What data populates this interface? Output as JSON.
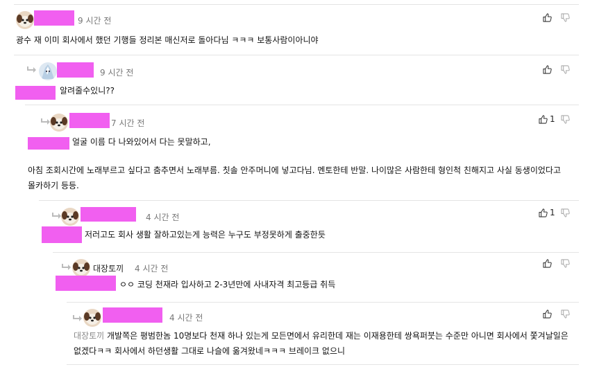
{
  "comments": [
    {
      "time": "9 시간 전",
      "body": "광수 재 이미 회사에서 했던 기행들 정리본 매신저로 돌아다님 ㅋㅋㅋ 보통사람이아니야",
      "likes": "",
      "avatar_icon": "dog-avatar-icon"
    },
    {
      "time": "9 시간 전",
      "body": "알려줄수있니??",
      "likes": "",
      "avatar_icon": "ice-avatar-icon"
    },
    {
      "time": "7 시간 전",
      "body_line1": "얼굴 이름 다 나와있어서 다는 못말하고,",
      "body_para2": "아침 조회시간에 노래부르고 싶다고 춤추면서 노래부름. 칫솔 안주머니에 넣고다님. 멘토한테 반말. 나이많은 사람한테 형인척 친해지고 사실 동생이었다고 몰카하기 등등.",
      "likes": "1",
      "avatar_icon": "dog-avatar-icon"
    },
    {
      "time": "4 시간 전",
      "body": "저러고도 회사 생활 잘하고있는게 능력은 누구도 부정못하게 출중한듯",
      "likes": "1",
      "avatar_icon": "dog-avatar-icon"
    },
    {
      "username": "대장토끼",
      "time": "4 시간 전",
      "body": "ㅇㅇ 코딩 천재라 입사하고 2-3년만에 사내자격 최고등급 취득",
      "likes": "",
      "avatar_icon": "dog-avatar-icon"
    },
    {
      "time": "4 시간 전",
      "mention": "대장토끼",
      "body": "개발쪽은 평범한놈 10명보다 천재 하나 있는게 모든면에서 유리한데 재는 이재용한테 쌍욕퍼붓는 수준만 아니면 회사에서 쫓겨날일은 없겠다ㅋㅋ 회사에서 하던생활 그대로 나슬에 옮겨왔네ㅋㅋㅋ 브레이크 없으니",
      "likes": "",
      "avatar_icon": "dog-avatar-icon"
    }
  ],
  "colors": {
    "redaction": "#f15ff0",
    "divider": "#e4e4e4",
    "timestamp": "#777777",
    "mention": "#8a8a8a"
  },
  "icons": {
    "like": "thumbs-up-icon",
    "dislike": "thumbs-down-icon",
    "reply": "reply-arrow-icon"
  }
}
